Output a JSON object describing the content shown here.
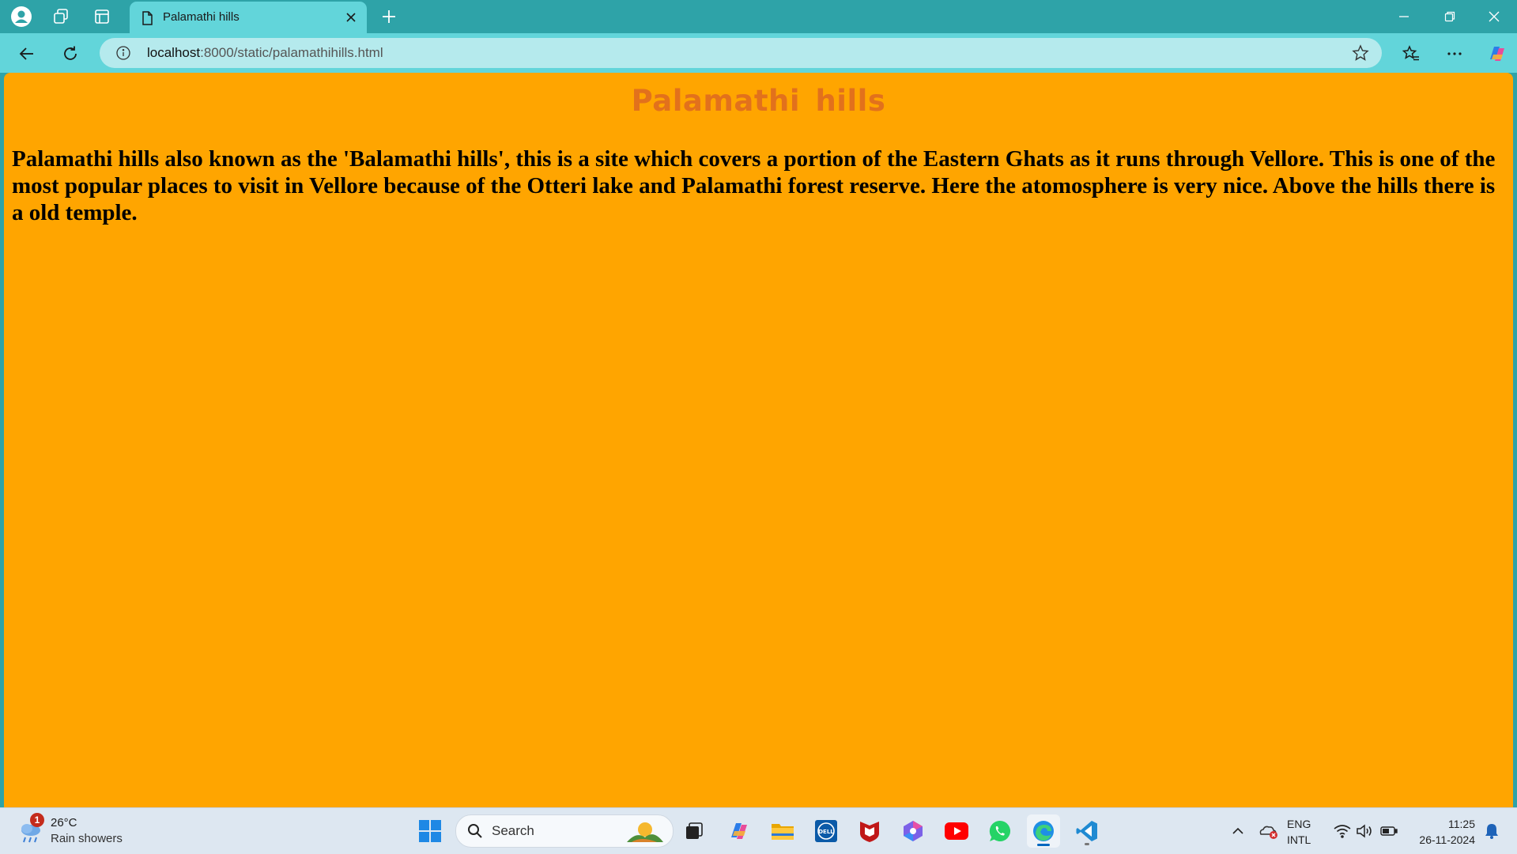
{
  "browser": {
    "tab": {
      "title": "Palamathi hills"
    },
    "address": {
      "host": "localhost",
      "path": ":8000/static/palamathihills.html"
    }
  },
  "page": {
    "heading": "Palamathi hills",
    "paragraph": "Palamathi hills also known as the 'Balamathi hills', this is a site which covers a portion of the Eastern Ghats as it runs through Vellore. This is one of the most popular places to visit in Vellore because of the Otteri lake and Palamathi forest reserve. Here the atomosphere is very nice. Above the hills there is a old temple.",
    "colors": {
      "background": "#ffa500",
      "heading": "#e2711c",
      "text": "#000000"
    }
  },
  "taskbar": {
    "weather": {
      "badge": "1",
      "temp": "26°C",
      "desc": "Rain showers"
    },
    "search_label": "Search",
    "language": {
      "line1": "ENG",
      "line2": "INTL"
    },
    "clock": {
      "time": "11:25",
      "date": "26-11-2024"
    },
    "apps": [
      "start-icon",
      "task-view-icon",
      "copilot-icon",
      "file-explorer-icon",
      "dell-icon",
      "mcafee-icon",
      "microsoft-365-icon",
      "youtube-icon",
      "whatsapp-icon",
      "edge-icon",
      "vscode-icon"
    ]
  }
}
